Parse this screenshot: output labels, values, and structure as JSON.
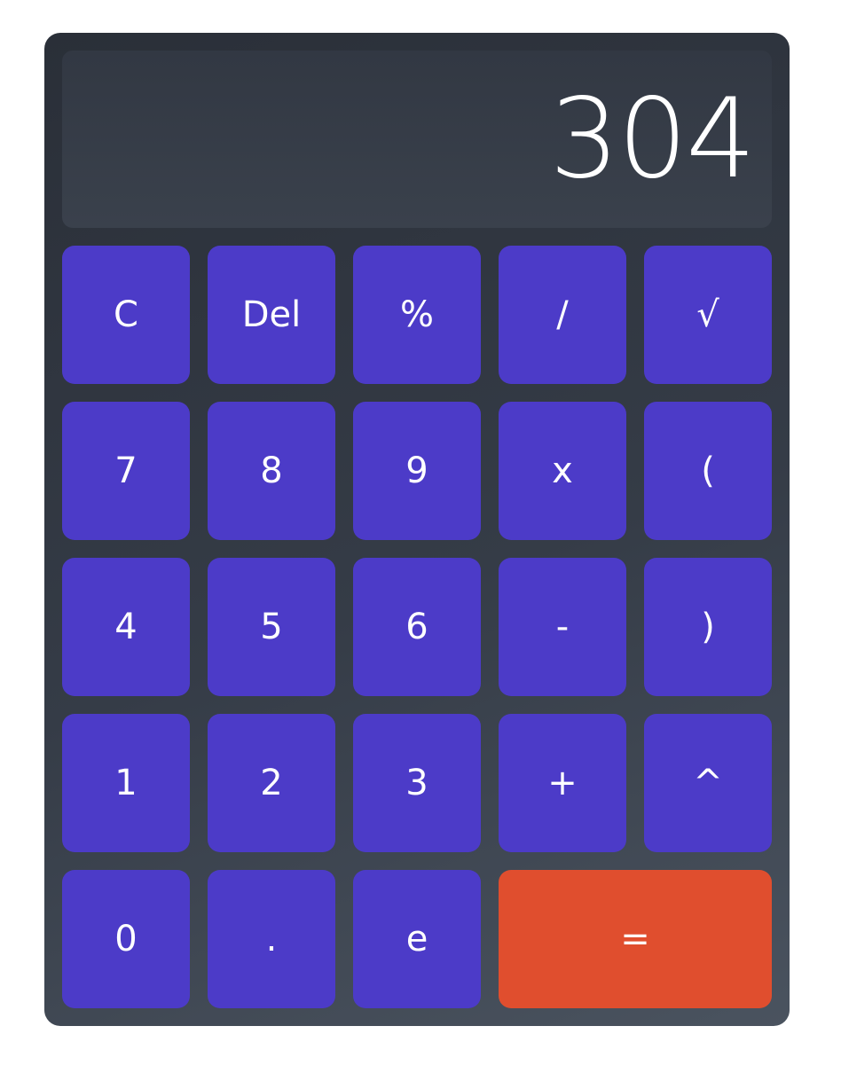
{
  "display": {
    "value": "304"
  },
  "keys": [
    {
      "label": "C"
    },
    {
      "label": "Del"
    },
    {
      "label": "%"
    },
    {
      "label": "/"
    },
    {
      "label": "√"
    },
    {
      "label": "7"
    },
    {
      "label": "8"
    },
    {
      "label": "9"
    },
    {
      "label": "x"
    },
    {
      "label": "("
    },
    {
      "label": "4"
    },
    {
      "label": "5"
    },
    {
      "label": "6"
    },
    {
      "label": "-"
    },
    {
      "label": ")"
    },
    {
      "label": "1"
    },
    {
      "label": "2"
    },
    {
      "label": "3"
    },
    {
      "label": "+"
    },
    {
      "label": "^"
    },
    {
      "label": "0"
    },
    {
      "label": "."
    },
    {
      "label": "e"
    },
    {
      "label": "="
    }
  ],
  "colors": {
    "key_background": "#4c3bc8",
    "equals_background": "#e04e2e",
    "calculator_background": "#353c47",
    "display_background": "#363c47",
    "text": "#ffffff"
  }
}
